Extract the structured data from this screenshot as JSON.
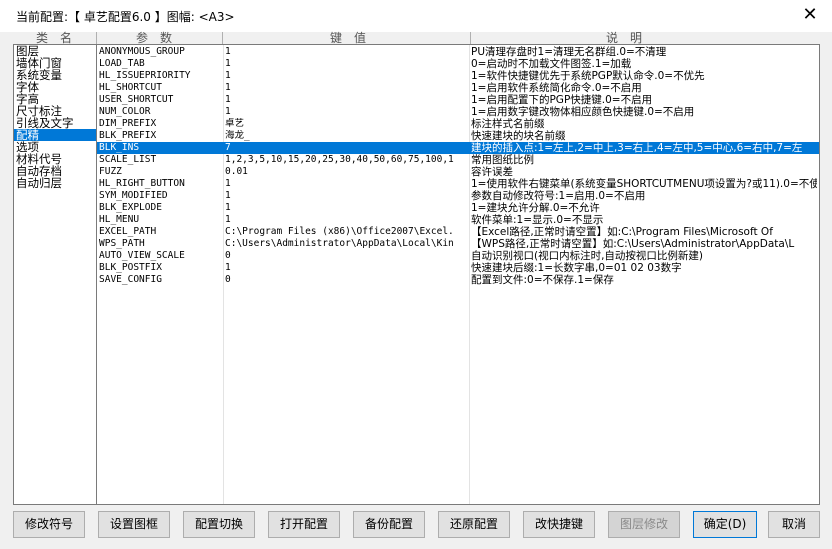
{
  "window": {
    "title": "当前配置:【 卓艺配置6.0 】图幅: <A3>",
    "close_glyph": "✕"
  },
  "headers": {
    "category": "类名",
    "param": "参数",
    "value": "键值",
    "desc": "说明"
  },
  "categories": [
    "图层",
    "墙体门窗",
    "系统变量",
    "字体",
    "字高",
    "尺寸标注",
    "引线及文字",
    "配精",
    "选项",
    "材料代号",
    "自动存档",
    "自动归层"
  ],
  "rows": [
    {
      "key": "ANONYMOUS_GROUP",
      "value": "1",
      "desc": "PU清理存盘时1=清理无名群组.0=不清理"
    },
    {
      "key": "LOAD_TAB",
      "value": "1",
      "desc": "0=启动时不加载文件图签.1=加载"
    },
    {
      "key": "HL_ISSUEPRIORITY",
      "value": "1",
      "desc": "1=软件快捷键优先于系统PGP默认命令.0=不优先"
    },
    {
      "key": "HL_SHORTCUT",
      "value": "1",
      "desc": "1=启用软件系统简化命令.0=不启用"
    },
    {
      "key": "USER_SHORTCUT",
      "value": "1",
      "desc": "1=启用配置下的PGP快捷键.0=不启用"
    },
    {
      "key": "NUM_COLOR",
      "value": "1",
      "desc": "1=启用数字键改物体相应颜色快捷键.0=不启用"
    },
    {
      "key": "DIM_PREFIX",
      "value": "卓艺",
      "desc": "标注样式名前缀"
    },
    {
      "key": "BLK_PREFIX",
      "value": "海龙_",
      "desc": "快速建块的块名前缀"
    },
    {
      "key": "BLK_INS",
      "value": "7",
      "desc": "建块的插入点:1=左上,2=中上,3=右上,4=左中,5=中心,6=右中,7=左"
    },
    {
      "key": "SCALE_LIST",
      "value": "1,2,3,5,10,15,20,25,30,40,50,60,75,100,1",
      "desc": "常用图纸比例"
    },
    {
      "key": "FUZZ",
      "value": "0.01",
      "desc": "容许误差"
    },
    {
      "key": "HL_RIGHT_BUTTON",
      "value": "1",
      "desc": "1=使用软件右键菜单(系统变量SHORTCUTMENU项设置为?或11).0=不使"
    },
    {
      "key": "SYM_MODIFIED",
      "value": "1",
      "desc": "参数自动修改符号:1=启用.0=不启用"
    },
    {
      "key": "BLK_EXPLODE",
      "value": "1",
      "desc": "1=建块允许分解.0=不允许"
    },
    {
      "key": "HL_MENU",
      "value": "1",
      "desc": "软件菜单:1=显示.0=不显示"
    },
    {
      "key": "EXCEL_PATH",
      "value": "C:\\Program Files (x86)\\Office2007\\Excel.",
      "desc": "【Excel路径,正常时请空置】如:C:\\Program Files\\Microsoft Of"
    },
    {
      "key": "WPS_PATH",
      "value": "C:\\Users\\Administrator\\AppData\\Local\\Kin",
      "desc": "【WPS路径,正常时请空置】如:C:\\Users\\Administrator\\AppData\\L"
    },
    {
      "key": "AUTO_VIEW_SCALE",
      "value": "0",
      "desc": "自动识别视口(视口内标注时,自动按视口比例新建)"
    },
    {
      "key": "BLK_POSTFIX",
      "value": "1",
      "desc": "快速建块后缀:1=长数字串,0=01 02 03数字"
    },
    {
      "key": "SAVE_CONFIG",
      "value": "0",
      "desc": "配置到文件:0=不保存.1=保存"
    }
  ],
  "buttons": [
    "修改符号",
    "设置图框",
    "配置切换",
    "打开配置",
    "备份配置",
    "还原配置",
    "改快捷键",
    "图层修改",
    "确定(D)",
    "取消"
  ]
}
